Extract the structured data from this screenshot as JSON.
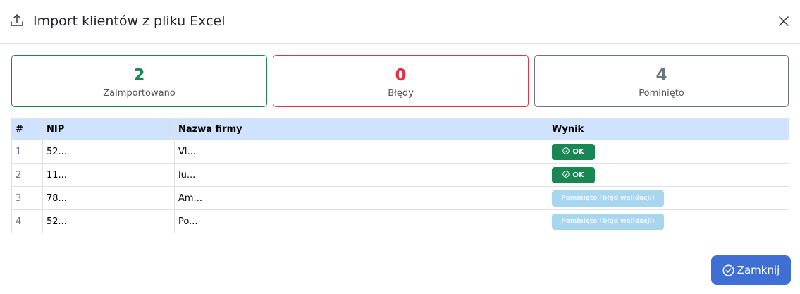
{
  "header": {
    "title": "Import klientów z pliku Excel",
    "icon": "upload-icon"
  },
  "stats": [
    {
      "value": "2",
      "label": "Zaimportowano",
      "color": "#198754"
    },
    {
      "value": "0",
      "label": "Błędy",
      "color": "#dc3545"
    },
    {
      "value": "4",
      "label": "Pominięto",
      "color": "#6c757d"
    }
  ],
  "table": {
    "headers": [
      "#",
      "NIP",
      "Nazwa firmy",
      "Wynik"
    ],
    "rows": [
      {
        "idx": "1",
        "nip": "52...",
        "name": "Vl...",
        "result": "OK",
        "status": "ok"
      },
      {
        "idx": "2",
        "nip": "11...",
        "name": "lu...",
        "result": "OK",
        "status": "ok"
      },
      {
        "idx": "3",
        "nip": "78...",
        "name": "Am...",
        "result": "Pominięto (błąd walidacji)",
        "status": "skip"
      },
      {
        "idx": "4",
        "nip": "52...",
        "name": "Po...",
        "result": "Pominięto (błąd walidacji)",
        "status": "skip"
      }
    ]
  },
  "footer": {
    "close_label": "Zamknij"
  },
  "colors": {
    "header_bg": "#cfe2ff",
    "ok_badge": "#198754",
    "skip_badge": "#a8d6ee",
    "primary_button": "#3f6fd4"
  }
}
